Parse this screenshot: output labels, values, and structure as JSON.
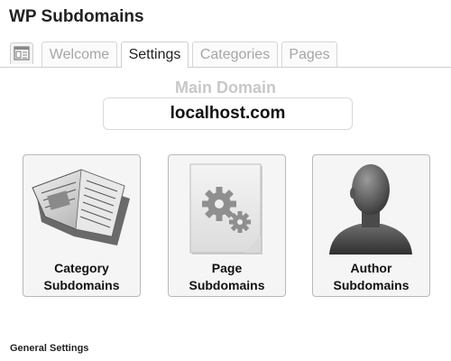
{
  "app": {
    "title": "WP Subdomains"
  },
  "tabs": [
    {
      "label": "Welcome",
      "active": false
    },
    {
      "label": "Settings",
      "active": true
    },
    {
      "label": "Categories",
      "active": false
    },
    {
      "label": "Pages",
      "active": false
    }
  ],
  "tab_icon": "dashboard-icon",
  "main_domain": {
    "label": "Main Domain",
    "value": "localhost.com"
  },
  "cards": [
    {
      "line1": "Category",
      "line2": "Subdomains",
      "icon": "newspaper-icon"
    },
    {
      "line1": "Page",
      "line2": "Subdomains",
      "icon": "gears-document-icon"
    },
    {
      "line1": "Author",
      "line2": "Subdomains",
      "icon": "person-bust-icon"
    }
  ],
  "general_settings": {
    "label": "General Settings"
  },
  "colors": {
    "inactive_tab_text": "#a6a6a6",
    "muted_label": "#c8c8c8",
    "card_bg": "#f5f5f5"
  }
}
